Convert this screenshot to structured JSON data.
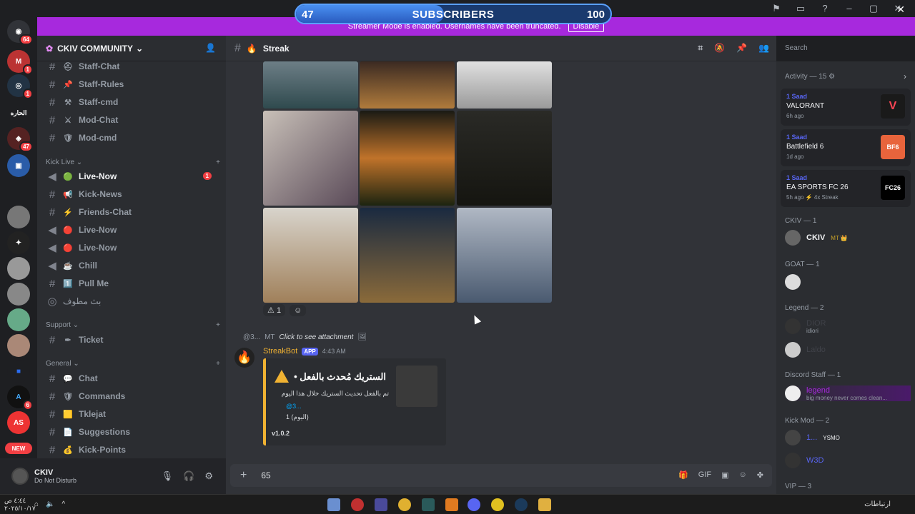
{
  "subscribers": {
    "current": "47",
    "label": "SUBSCRIBERS",
    "goal": "100",
    "progress": 0.47,
    "overlay_text": "CKIV COMMUNITY"
  },
  "banner": {
    "text": "Streamer Mode is enabled. Usernames have been truncated.",
    "button": "Disable"
  },
  "rail": {
    "badges": [
      "64",
      "1",
      "1",
      "47",
      "6"
    ],
    "arabic_label": "الحاره",
    "new_label": "NEW"
  },
  "guild": {
    "name": "CKIV COMMUNITY"
  },
  "channels": [
    {
      "name": "Staff-Chat",
      "emoji": "⛑",
      "type": "text"
    },
    {
      "name": "Staff-Rules",
      "emoji": "📌",
      "type": "text"
    },
    {
      "name": "Staff-cmd",
      "emoji": "⚒",
      "type": "text"
    },
    {
      "name": "Mod-Chat",
      "emoji": "⚔",
      "type": "text"
    }
  ],
  "mod_cmd": {
    "name": "Mod-cmd",
    "emoji": "🛡"
  },
  "category_kick": {
    "label": "Kick Live ⌄",
    "add": "+"
  },
  "kick_channels": [
    {
      "name": "Live-Now",
      "emoji": "🟢",
      "active": true,
      "unread": "1"
    },
    {
      "name": "Kick-News",
      "emoji": "📢"
    },
    {
      "name": "Friends-Chat",
      "emoji": "⚡"
    },
    {
      "name": "Live-Now",
      "emoji": "🔴"
    },
    {
      "name": "Live-Now",
      "emoji": "🔴"
    },
    {
      "name": "Chill",
      "emoji": "☕"
    },
    {
      "name": "Pull Me",
      "emoji": "1️⃣"
    },
    {
      "name": "بث مطوف",
      "emoji": ""
    }
  ],
  "category_support": {
    "label": "Support ⌄",
    "add": "+"
  },
  "support_channels": [
    {
      "name": "Ticket",
      "emoji": "✒"
    }
  ],
  "category_general": {
    "label": "General ⌄",
    "add": "+"
  },
  "general_channels": [
    {
      "name": "Chat",
      "emoji": "💬"
    },
    {
      "name": "Commands",
      "emoji": "🛡"
    },
    {
      "name": "Tklejat",
      "emoji": "🟨"
    },
    {
      "name": "Suggestions",
      "emoji": "📄"
    },
    {
      "name": "Kick-Points",
      "emoji": "💰"
    }
  ],
  "user": {
    "name": "CKIV",
    "status": "Do Not Disturb"
  },
  "channel_header": {
    "name": "Streak",
    "emoji": "🔥"
  },
  "search": {
    "placeholder": "Search"
  },
  "reactions": [
    {
      "emoji": "⚠",
      "count": "1"
    }
  ],
  "reply": {
    "name": "@3...",
    "tag": "MT",
    "text": "Click to see attachment"
  },
  "bot": {
    "name": "StreakBot",
    "tag": "APP",
    "time": "4:43 AM"
  },
  "embed": {
    "title": "الستريك مُحدث بالفعل •",
    "line1": "تم بالفعل تحديث الستريك خلال هذا اليوم",
    "line2": "@3...",
    "line3": "1 (اليوم)",
    "footer": "v1.0.2"
  },
  "composer": {
    "value": "65"
  },
  "activity": {
    "title": "Activity — 15 ⚙",
    "items": [
      {
        "user": "1 Saad",
        "game": "VALORANT",
        "time": "6h ago",
        "logo": "V",
        "color": "#ff4655"
      },
      {
        "user": "1 Saad",
        "game": "Battlefield 6",
        "time": "1d ago",
        "logo": "BF6",
        "color": "#e8643c"
      },
      {
        "user": "1 Saad",
        "game": "EA SPORTS FC 26",
        "time": "5h ago  ⚡ 4x Streak",
        "logo": "FC26",
        "color": "#000000"
      }
    ]
  },
  "members": {
    "groups": [
      {
        "title": "CKIV — 1",
        "members": [
          {
            "name": "CKIV",
            "extra": "MT 👑",
            "color": "#f2f3f5"
          }
        ]
      },
      {
        "title": "GOAT — 1",
        "members": [
          {
            "name": "",
            "extra": "",
            "color": "#1e1f80"
          }
        ]
      },
      {
        "title": "Legend — 2",
        "members": [
          {
            "name": "DIOR",
            "extra": "idiori",
            "color": "#2b2d31"
          },
          {
            "name": "Laldo",
            "extra": "",
            "color": "#2b2d31"
          }
        ]
      },
      {
        "title": "Discord Staff — 1",
        "members": [
          {
            "name": "legend",
            "extra": "big money never comes clean...",
            "color": "#a729dd"
          }
        ]
      },
      {
        "title": "Kick Mod — 2",
        "members": [
          {
            "name": "1...",
            "extra": "YSMO",
            "color": "#5865f2"
          },
          {
            "name": "W3D",
            "extra": "",
            "color": "#5865f2"
          }
        ]
      },
      {
        "title": "VIP — 3",
        "members": []
      }
    ]
  },
  "taskbar": {
    "clock": "٤:٤٤ ص\n٢٠٢٥/١٠/١٧",
    "links": "ارتباطات"
  }
}
